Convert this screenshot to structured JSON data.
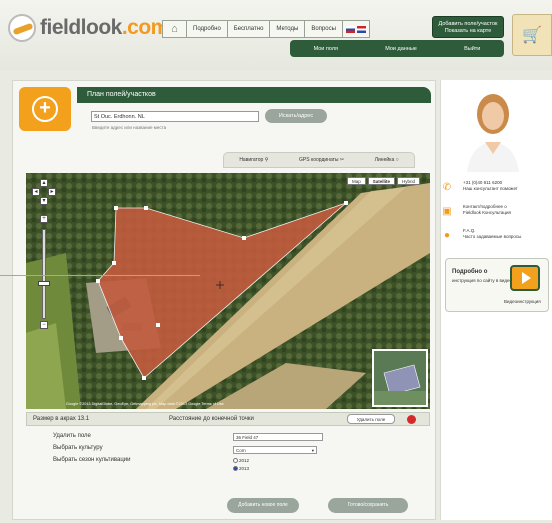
{
  "header": {
    "logo_part1": "fieldlook",
    "logo_part2": ".com",
    "nav": [
      "Подробно",
      "Бесплатно",
      "Методы",
      "Вопросы"
    ],
    "add_button": "Добавить поле/участок",
    "add_button_line2": "Показать на карте",
    "subnav": [
      "Мои поля",
      "Мои данные",
      "Выйти"
    ]
  },
  "panel": {
    "title": "План полей/участков",
    "search_value": "St Ouc. Erdhonn. NL",
    "search_button": "Искать/адрес",
    "search_hint": "Введите адрес или название места",
    "tools": [
      "Навигатор",
      "GPS координаты",
      "Линейка"
    ]
  },
  "map": {
    "types": [
      "Map",
      "Satellite",
      "Hybrid"
    ],
    "active_type": "Satellite",
    "copyright": "Google  ©2013 DigitalGlobe, GeoEye, Getmapping plc, Map data ©2013 Google  Terms of Use"
  },
  "status": {
    "scale": "Размер в акрах   13.1",
    "distance": "Расстояние до конечной точки",
    "button": "Удалить поле"
  },
  "form": {
    "row1_label": "Удалить поле",
    "row1_value": "36 Field 47",
    "row2_label": "Выбрать культуру",
    "row2_value": "Corn",
    "row3_label": "Выбрать сезон культивации",
    "season_options": [
      "2012",
      "2013"
    ],
    "season_selected": "2013",
    "btn_left": "Добавить новое поле",
    "btn_right": "Готово/сохранить"
  },
  "sidebar": {
    "phone": "+31 (0)40 811 6200",
    "phone_sub": "Наш консультант поможет",
    "contact2": "Контакт/подробнее о",
    "contact2_sub": "Fieldlook Консультация",
    "faq": "F.A.Q.",
    "faq_sub": "Часто задаваемые вопросы",
    "video_title": "Подробно о",
    "video_text": "инструкция по сайту в видео",
    "video_label": "Видеоинструкция"
  }
}
